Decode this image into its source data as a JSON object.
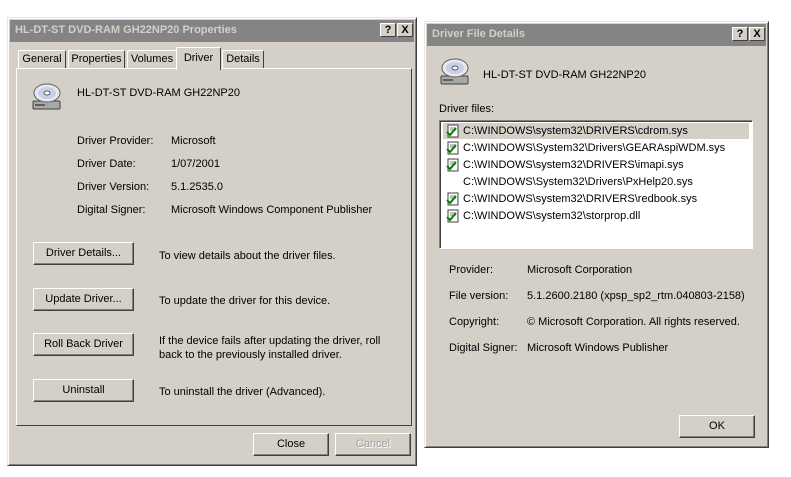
{
  "left_dialog": {
    "title": "HL-DT-ST DVD-RAM GH22NP20 Properties",
    "help_btn": "?",
    "close_btn": "X",
    "tabs": [
      "General",
      "Properties",
      "Volumes",
      "Driver",
      "Details"
    ],
    "active_tab": "Driver",
    "device_name": "HL-DT-ST DVD-RAM GH22NP20",
    "info": [
      {
        "label": "Driver Provider:",
        "value": "Microsoft"
      },
      {
        "label": "Driver Date:",
        "value": "1/07/2001"
      },
      {
        "label": "Driver Version:",
        "value": "5.1.2535.0"
      },
      {
        "label": "Digital Signer:",
        "value": "Microsoft Windows Component Publisher"
      }
    ],
    "actions": [
      {
        "button": "Driver Details...",
        "desc": "To view details about the driver files."
      },
      {
        "button": "Update Driver...",
        "desc": "To update the driver for this device."
      },
      {
        "button": "Roll Back Driver",
        "desc": "If the device fails after updating the driver, roll back to the previously installed driver."
      },
      {
        "button": "Uninstall",
        "desc": "To uninstall the driver (Advanced)."
      }
    ],
    "close_label": "Close",
    "cancel_label": "Cancel"
  },
  "right_dialog": {
    "title": "Driver File Details",
    "help_btn": "?",
    "close_btn": "X",
    "device_name": "HL-DT-ST DVD-RAM GH22NP20",
    "files_label": "Driver files:",
    "files": [
      {
        "path": "C:\\WINDOWS\\system32\\DRIVERS\\cdrom.sys",
        "signed": true,
        "selected": true
      },
      {
        "path": "C:\\WINDOWS\\System32\\Drivers\\GEARAspiWDM.sys",
        "signed": true,
        "selected": false
      },
      {
        "path": "C:\\WINDOWS\\system32\\DRIVERS\\imapi.sys",
        "signed": true,
        "selected": false
      },
      {
        "path": "C:\\WINDOWS\\System32\\Drivers\\PxHelp20.sys",
        "signed": false,
        "selected": false
      },
      {
        "path": "C:\\WINDOWS\\system32\\DRIVERS\\redbook.sys",
        "signed": true,
        "selected": false
      },
      {
        "path": "C:\\WINDOWS\\system32\\storprop.dll",
        "signed": true,
        "selected": false
      }
    ],
    "details": [
      {
        "label": "Provider:",
        "value": "Microsoft Corporation"
      },
      {
        "label": "File version:",
        "value": "5.1.2600.2180 (xpsp_sp2_rtm.040803-2158)"
      },
      {
        "label": "Copyright:",
        "value": "© Microsoft Corporation. All rights reserved."
      },
      {
        "label": "Digital Signer:",
        "value": "Microsoft Windows Publisher"
      }
    ],
    "ok_label": "OK"
  },
  "colors": {
    "dialog_face": "#d4d0c8",
    "inactive_title": "#848484",
    "inactive_title_text": "#d4d0c8",
    "list_background": "#ffffff"
  },
  "icons": {
    "device": "dvd-drive-icon",
    "file": "signed-driver-file-icon"
  }
}
